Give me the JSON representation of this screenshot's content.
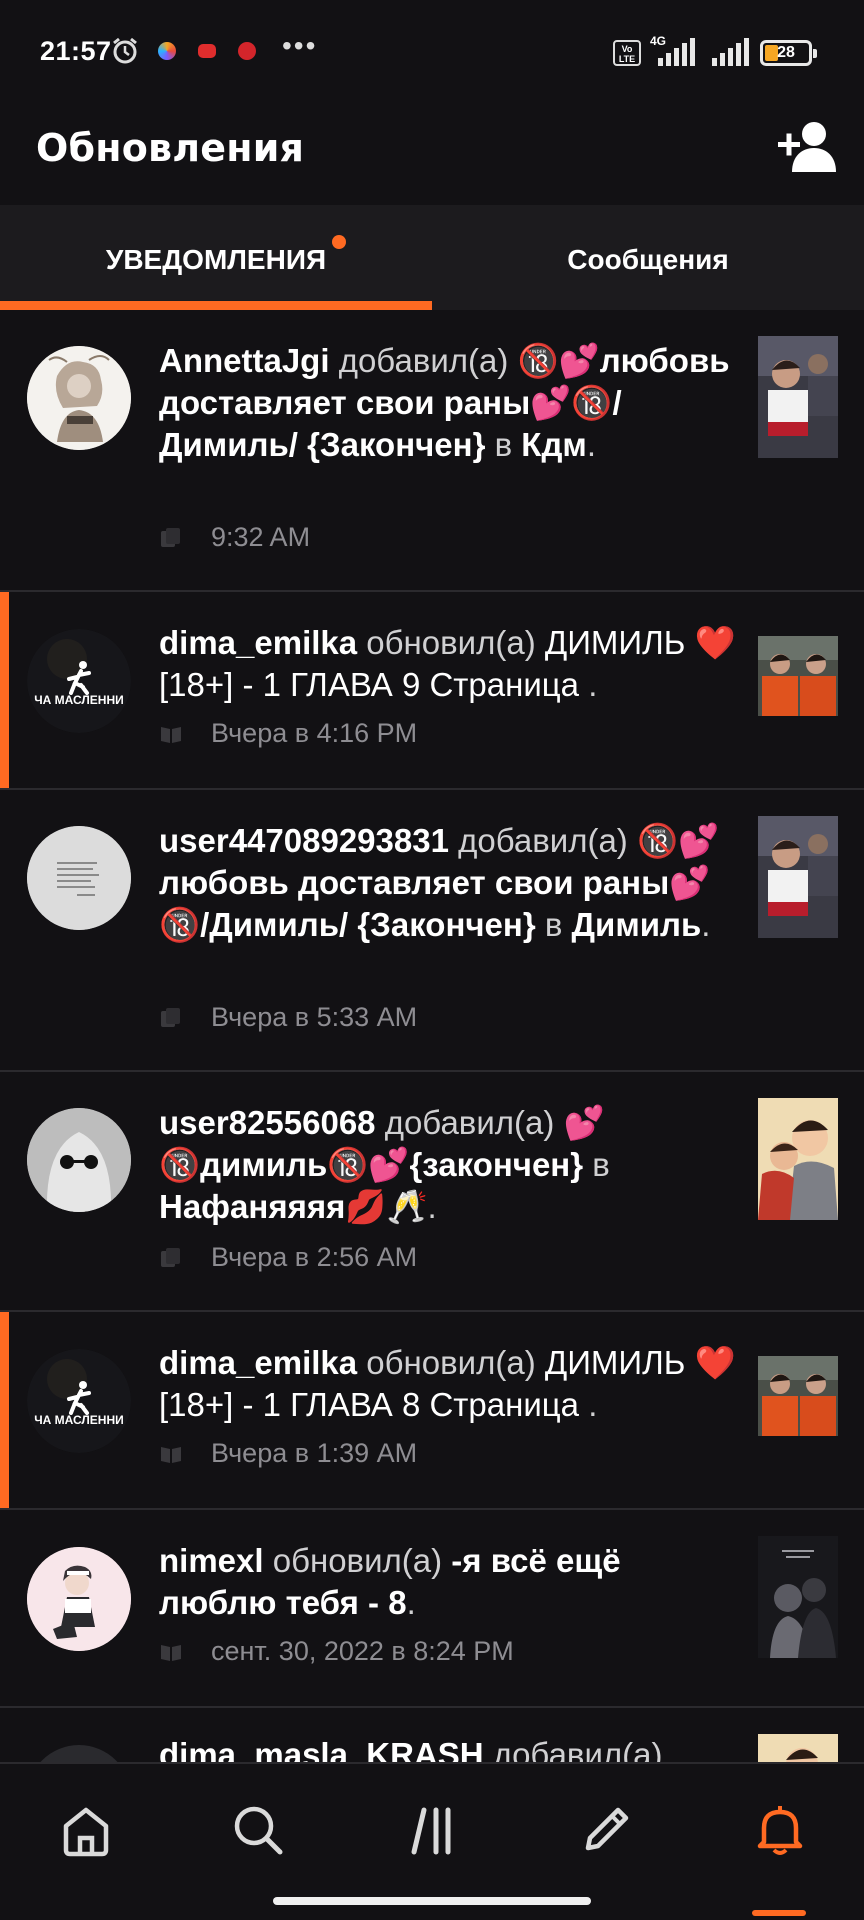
{
  "status_bar": {
    "time": "21:57",
    "battery": "28",
    "volte": "Vo LTE",
    "network": "4G"
  },
  "header": {
    "title": "Обновления",
    "add_user_icon": "add-user-icon"
  },
  "tabs": [
    {
      "label": "УВЕДОМЛЕНИЯ",
      "active": true,
      "has_badge": true
    },
    {
      "label": "Сообщения",
      "active": false
    }
  ],
  "notifications": [
    {
      "user": "AnnettaJgi",
      "action": "добавил(а)",
      "story": "🔞💕любовь доставляет свои раны💕🔞/Димиль/ {Закончен}",
      "connector": "в",
      "target": "Кдм",
      "time": "9:32 AM",
      "highlight": false
    },
    {
      "user": "dima_emilka",
      "action": "обновил(а)",
      "story": "ДИМИЛЬ ❤️[18+] - 1 ГЛАВА 9 Страница",
      "connector": "",
      "target": "",
      "time": "Вчера в 4:16 PM",
      "highlight": true,
      "avatar_caption": "ЧА МАСЛЕННИ"
    },
    {
      "user": "user447089293831",
      "action": "добавил(а)",
      "story": "🔞💕любовь доставляет свои раны💕🔞/Димиль/ {Закончен}",
      "connector": "в",
      "target": "Димиль",
      "time": "Вчера в 5:33 AM",
      "highlight": false
    },
    {
      "user": "user82556068",
      "action": "добавил(а)",
      "story": "💕🔞димиль🔞💕{закончен}",
      "connector": "в",
      "target": "Нафаняяяя💋🥂",
      "time": "Вчера в 2:56 AM",
      "highlight": false
    },
    {
      "user": "dima_emilka",
      "action": "обновил(а)",
      "story": "ДИМИЛЬ ❤️[18+] - 1 ГЛАВА 8 Страница",
      "connector": "",
      "target": "",
      "time": "Вчера в 1:39 AM",
      "highlight": true,
      "avatar_caption": "ЧА МАСЛЕННИ"
    },
    {
      "user": "nimexl",
      "action": "обновил(а)",
      "story": "-я всё ещё люблю тебя - 8",
      "connector": "",
      "target": "",
      "time": "сент. 30, 2022 в 8:24 PM",
      "highlight": false
    },
    {
      "user": "dima_masla_KRASH",
      "action": "добавил(а)",
      "story": "",
      "connector": "",
      "target": "",
      "time": "",
      "highlight": false
    }
  ],
  "bottom_nav": [
    {
      "icon": "home-icon",
      "active": false
    },
    {
      "icon": "search-icon",
      "active": false
    },
    {
      "icon": "library-icon",
      "active": false
    },
    {
      "icon": "pencil-icon",
      "active": false
    },
    {
      "icon": "bell-icon",
      "active": true
    }
  ],
  "colors": {
    "accent": "#ff6a22",
    "background": "#121114",
    "tab_bar": "#1c1b1e",
    "muted_text": "#8e8d92"
  }
}
